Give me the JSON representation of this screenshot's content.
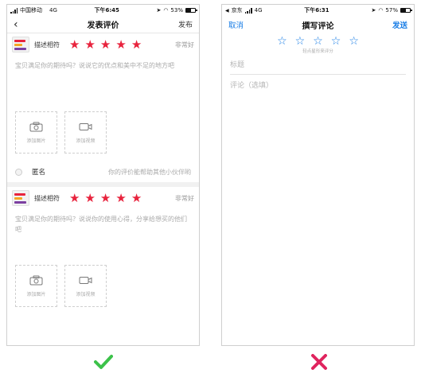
{
  "left": {
    "status": {
      "carrier": "中国移动",
      "network": "4G",
      "time": "下午6:45",
      "battery": "53%",
      "battery_level": 0.53
    },
    "nav": {
      "back_icon": "‹",
      "title": "发表评价",
      "publish": "发布"
    },
    "reviews": [
      {
        "product_name": "描述相符",
        "stars": [
          "★",
          "★",
          "★",
          "★",
          "★"
        ],
        "rating_text": "非常好",
        "placeholder": "宝贝满足你的期待吗？说说它的优点和美中不足的地方吧",
        "add_photo": "添加图片",
        "add_video": "添加视频"
      },
      {
        "product_name": "描述相符",
        "stars": [
          "★",
          "★",
          "★",
          "★",
          "★"
        ],
        "rating_text": "非常好",
        "placeholder": "宝贝满足你的期待吗？说说你的使用心得，分享给想买的他们吧",
        "add_photo": "添加图片",
        "add_video": "添加视频"
      }
    ],
    "anonymous": {
      "label": "匿名",
      "hint": "你的评价能帮助其他小伙伴哟"
    }
  },
  "right": {
    "status": {
      "app": "京东",
      "network": "4G",
      "time": "下午6:31",
      "battery": "57%",
      "battery_level": 0.57
    },
    "nav": {
      "cancel": "取消",
      "title": "撰写评论",
      "send": "发送"
    },
    "stars": [
      "☆",
      "☆",
      "☆",
      "☆",
      "☆"
    ],
    "tap_hint": "轻点星形来评分",
    "title_placeholder": "标题",
    "comment_placeholder": "评论（选填）"
  },
  "verdicts": {
    "good": "check-icon",
    "bad": "cross-icon",
    "good_color": "#3cc24a",
    "bad_color": "#e0245e"
  },
  "colors": {
    "star_red": "#e8233d",
    "accent_blue": "#1a7ee6"
  }
}
